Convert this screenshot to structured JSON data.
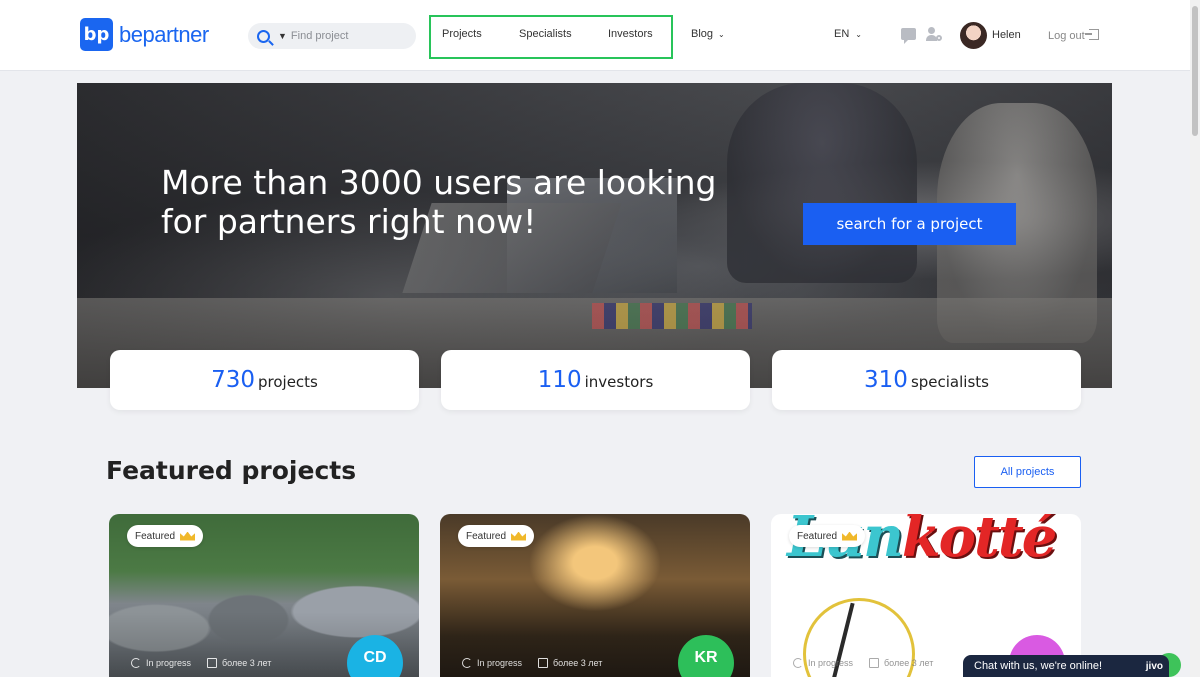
{
  "header": {
    "logo_mark": "bp",
    "logo_text": "bepartner",
    "search_placeholder": "Find project",
    "nav": {
      "projects": "Projects",
      "specialists": "Specialists",
      "investors": "Investors",
      "blog": "Blog"
    },
    "language": "EN",
    "username": "Helen",
    "logout": "Log out"
  },
  "hero": {
    "title": "More than 3000 users are looking for partners right now!",
    "button": "search for a project"
  },
  "stats": [
    {
      "value": "730",
      "label": "projects"
    },
    {
      "value": "110",
      "label": "investors"
    },
    {
      "value": "310",
      "label": "specialists"
    }
  ],
  "featured": {
    "title": "Featured projects",
    "all_button": "All projects",
    "cards": [
      {
        "badge": "Featured",
        "status": "In progress",
        "duration": "более 3 лет",
        "avatar": "CD"
      },
      {
        "badge": "Featured",
        "status": "In progress",
        "duration": "более 3 лет",
        "avatar": "KR"
      },
      {
        "badge": "Featured",
        "status": "In progress",
        "duration": "более 3 лет",
        "avatar": "",
        "image_text_a": "Lun",
        "image_text_b": "kotté"
      }
    ]
  },
  "chat": {
    "text": "Chat with us, we're online!",
    "brand": "jivo"
  },
  "colors": {
    "primary": "#1a5ff2",
    "highlight_box": "#28c45a",
    "chat_bg": "#1b2740"
  }
}
